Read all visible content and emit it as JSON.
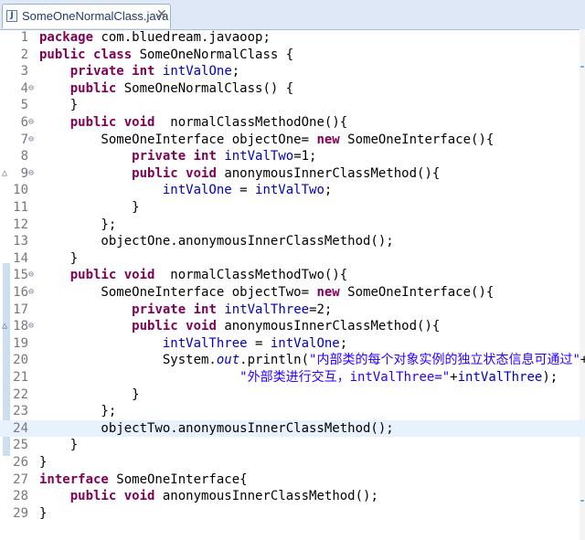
{
  "tab": {
    "title": "SomeOneNormalClass.java",
    "close_glyph": "✕",
    "icon": "java-file-icon",
    "icon_letter": "J"
  },
  "editor": {
    "current_line": 24,
    "lines": [
      {
        "n": "1",
        "fold": "",
        "override": false,
        "segs": [
          {
            "t": "package",
            "c": "kw"
          },
          {
            "t": " com.bluedream.javaoop;",
            "c": ""
          }
        ]
      },
      {
        "n": "2",
        "fold": "",
        "override": false,
        "segs": [
          {
            "t": "public",
            "c": "kw"
          },
          {
            "t": " ",
            "c": ""
          },
          {
            "t": "class",
            "c": "kw"
          },
          {
            "t": " SomeOneNormalClass {",
            "c": ""
          }
        ]
      },
      {
        "n": "3",
        "fold": "",
        "override": false,
        "segs": [
          {
            "t": "    ",
            "c": ""
          },
          {
            "t": "private",
            "c": "kw"
          },
          {
            "t": " ",
            "c": ""
          },
          {
            "t": "int",
            "c": "kw"
          },
          {
            "t": " ",
            "c": ""
          },
          {
            "t": "intValOne",
            "c": "fld"
          },
          {
            "t": ";",
            "c": ""
          }
        ]
      },
      {
        "n": "4",
        "fold": "⊖",
        "override": false,
        "segs": [
          {
            "t": "    ",
            "c": ""
          },
          {
            "t": "public",
            "c": "kw"
          },
          {
            "t": " SomeOneNormalClass() {",
            "c": ""
          }
        ]
      },
      {
        "n": "5",
        "fold": "",
        "override": false,
        "segs": [
          {
            "t": "    }",
            "c": ""
          }
        ]
      },
      {
        "n": "6",
        "fold": "⊖",
        "override": false,
        "segs": [
          {
            "t": "    ",
            "c": ""
          },
          {
            "t": "public",
            "c": "kw"
          },
          {
            "t": " ",
            "c": ""
          },
          {
            "t": "void",
            "c": "kw"
          },
          {
            "t": "  normalClassMethodOne(){",
            "c": ""
          }
        ]
      },
      {
        "n": "7",
        "fold": "⊖",
        "override": false,
        "segs": [
          {
            "t": "        SomeOneInterface objectOne= ",
            "c": ""
          },
          {
            "t": "new",
            "c": "kw"
          },
          {
            "t": " SomeOneInterface(){",
            "c": ""
          }
        ]
      },
      {
        "n": "8",
        "fold": "",
        "override": false,
        "segs": [
          {
            "t": "            ",
            "c": ""
          },
          {
            "t": "private",
            "c": "kw"
          },
          {
            "t": " ",
            "c": ""
          },
          {
            "t": "int",
            "c": "kw"
          },
          {
            "t": " ",
            "c": ""
          },
          {
            "t": "intValTwo",
            "c": "fld"
          },
          {
            "t": "=1;",
            "c": ""
          }
        ]
      },
      {
        "n": "9",
        "fold": "⊖",
        "override": true,
        "segs": [
          {
            "t": "            ",
            "c": ""
          },
          {
            "t": "public",
            "c": "kw"
          },
          {
            "t": " ",
            "c": ""
          },
          {
            "t": "void",
            "c": "kw"
          },
          {
            "t": " anonymousInnerClassMethod(){",
            "c": ""
          }
        ]
      },
      {
        "n": "10",
        "fold": "",
        "override": false,
        "segs": [
          {
            "t": "                ",
            "c": ""
          },
          {
            "t": "intValOne",
            "c": "fld"
          },
          {
            "t": " = ",
            "c": ""
          },
          {
            "t": "intValTwo",
            "c": "fld"
          },
          {
            "t": ";",
            "c": ""
          }
        ]
      },
      {
        "n": "11",
        "fold": "",
        "override": false,
        "segs": [
          {
            "t": "            }",
            "c": ""
          }
        ]
      },
      {
        "n": "12",
        "fold": "",
        "override": false,
        "segs": [
          {
            "t": "        };",
            "c": ""
          }
        ]
      },
      {
        "n": "13",
        "fold": "",
        "override": false,
        "segs": [
          {
            "t": "        objectOne.anonymousInnerClassMethod();",
            "c": ""
          }
        ]
      },
      {
        "n": "14",
        "fold": "",
        "override": false,
        "segs": [
          {
            "t": "    }",
            "c": ""
          }
        ]
      },
      {
        "n": "15",
        "fold": "⊖",
        "override": false,
        "segs": [
          {
            "t": "    ",
            "c": ""
          },
          {
            "t": "public",
            "c": "kw"
          },
          {
            "t": " ",
            "c": ""
          },
          {
            "t": "void",
            "c": "kw"
          },
          {
            "t": "  normalClassMethodTwo(){",
            "c": ""
          }
        ]
      },
      {
        "n": "16",
        "fold": "⊖",
        "override": false,
        "segs": [
          {
            "t": "        SomeOneInterface objectTwo= ",
            "c": ""
          },
          {
            "t": "new",
            "c": "kw"
          },
          {
            "t": " SomeOneInterface(){",
            "c": ""
          }
        ]
      },
      {
        "n": "17",
        "fold": "",
        "override": false,
        "segs": [
          {
            "t": "            ",
            "c": ""
          },
          {
            "t": "private",
            "c": "kw"
          },
          {
            "t": " ",
            "c": ""
          },
          {
            "t": "int",
            "c": "kw"
          },
          {
            "t": " ",
            "c": ""
          },
          {
            "t": "intValThree",
            "c": "fld"
          },
          {
            "t": "=2;",
            "c": ""
          }
        ]
      },
      {
        "n": "18",
        "fold": "⊖",
        "override": true,
        "segs": [
          {
            "t": "            ",
            "c": ""
          },
          {
            "t": "public",
            "c": "kw"
          },
          {
            "t": " ",
            "c": ""
          },
          {
            "t": "void",
            "c": "kw"
          },
          {
            "t": " anonymousInnerClassMethod(){",
            "c": ""
          }
        ]
      },
      {
        "n": "19",
        "fold": "",
        "override": false,
        "segs": [
          {
            "t": "                ",
            "c": ""
          },
          {
            "t": "intValThree",
            "c": "fld"
          },
          {
            "t": " = ",
            "c": ""
          },
          {
            "t": "intValOne",
            "c": "fld"
          },
          {
            "t": ";",
            "c": ""
          }
        ]
      },
      {
        "n": "20",
        "fold": "",
        "override": false,
        "segs": [
          {
            "t": "                System.",
            "c": ""
          },
          {
            "t": "out",
            "c": "sfld"
          },
          {
            "t": ".println(",
            "c": ""
          },
          {
            "t": "\"内部类的每个对象实例的独立状态信息可通过\"",
            "c": "str"
          },
          {
            "t": "+",
            "c": ""
          }
        ]
      },
      {
        "n": "21",
        "fold": "",
        "override": false,
        "segs": [
          {
            "t": "                          ",
            "c": ""
          },
          {
            "t": "\"外部类进行交互，intValThree=\"",
            "c": "str"
          },
          {
            "t": "+",
            "c": ""
          },
          {
            "t": "intValThree",
            "c": "fld"
          },
          {
            "t": ");",
            "c": ""
          }
        ]
      },
      {
        "n": "22",
        "fold": "",
        "override": false,
        "segs": [
          {
            "t": "            }",
            "c": ""
          }
        ]
      },
      {
        "n": "23",
        "fold": "",
        "override": false,
        "segs": [
          {
            "t": "        };",
            "c": ""
          }
        ]
      },
      {
        "n": "24",
        "fold": "",
        "override": false,
        "segs": [
          {
            "t": "        objectTwo.anonymousInnerClassMethod();",
            "c": ""
          }
        ]
      },
      {
        "n": "25",
        "fold": "",
        "override": false,
        "segs": [
          {
            "t": "    }",
            "c": ""
          }
        ]
      },
      {
        "n": "26",
        "fold": "",
        "override": false,
        "segs": [
          {
            "t": "}",
            "c": ""
          }
        ]
      },
      {
        "n": "27",
        "fold": "",
        "override": false,
        "segs": [
          {
            "t": "interface",
            "c": "kw"
          },
          {
            "t": " SomeOneInterface{",
            "c": ""
          }
        ]
      },
      {
        "n": "28",
        "fold": "",
        "override": false,
        "segs": [
          {
            "t": "    ",
            "c": ""
          },
          {
            "t": "public",
            "c": "kw"
          },
          {
            "t": " ",
            "c": ""
          },
          {
            "t": "void",
            "c": "kw"
          },
          {
            "t": " anonymousInnerClassMethod();",
            "c": ""
          }
        ]
      },
      {
        "n": "29",
        "fold": "",
        "override": false,
        "segs": [
          {
            "t": "}",
            "c": ""
          }
        ]
      }
    ]
  }
}
